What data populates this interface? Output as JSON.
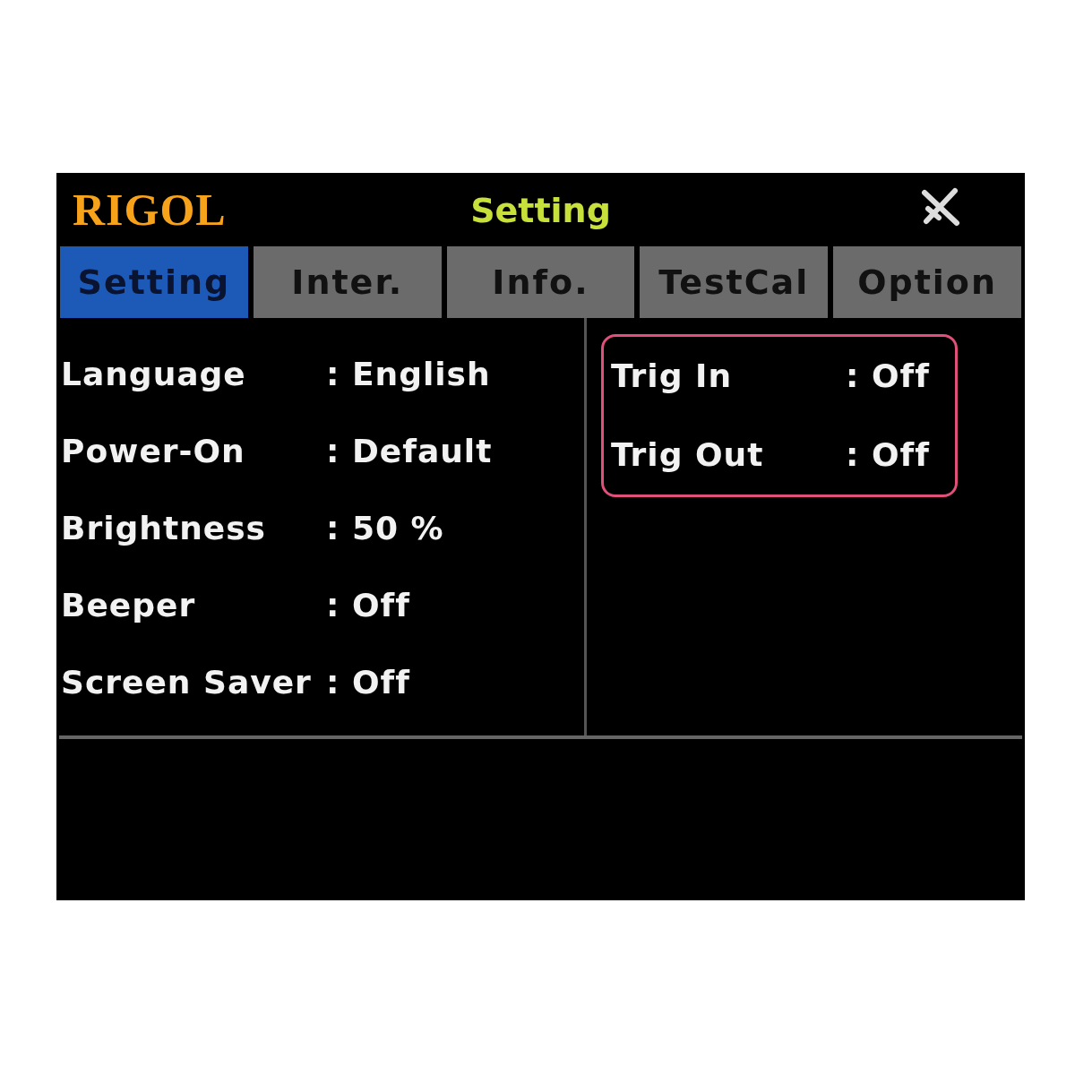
{
  "header": {
    "logo": "RIGOL",
    "title": "Setting"
  },
  "tabs": [
    {
      "label": "Setting",
      "selected": true
    },
    {
      "label": "Inter.",
      "selected": false
    },
    {
      "label": "Info.",
      "selected": false
    },
    {
      "label": "TestCal",
      "selected": false
    },
    {
      "label": "Option",
      "selected": false
    }
  ],
  "left_settings": [
    {
      "label": "Language",
      "value": ": English"
    },
    {
      "label": "Power-On",
      "value": ": Default"
    },
    {
      "label": "Brightness",
      "value": ": 50 %"
    },
    {
      "label": "Beeper",
      "value": ": Off"
    },
    {
      "label": "Screen Saver",
      "value": ": Off"
    }
  ],
  "right_settings": {
    "highlighted": true,
    "items": [
      {
        "label": "Trig In",
        "value": ": Off"
      },
      {
        "label": "Trig Out",
        "value": ": Off"
      }
    ]
  }
}
